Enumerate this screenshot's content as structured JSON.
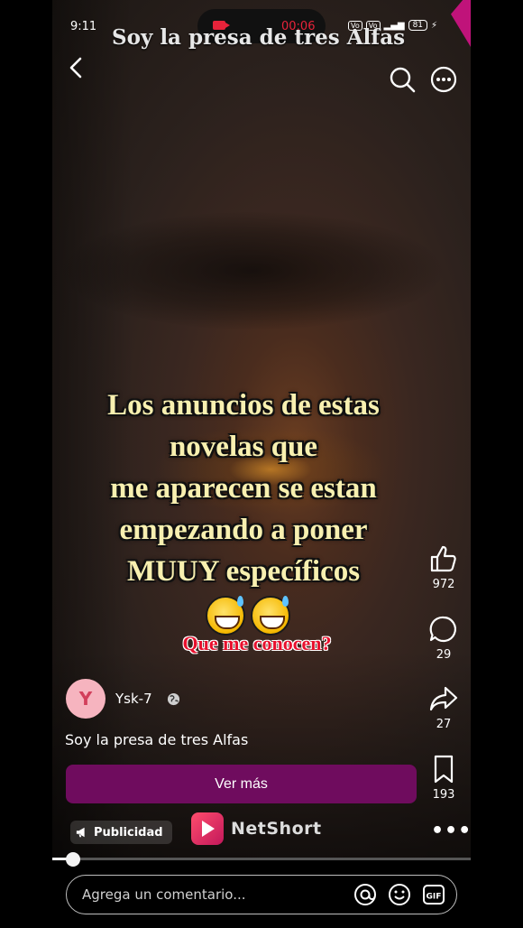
{
  "status_bar": {
    "time": "9:11",
    "recording_time": "00:06",
    "battery": "81"
  },
  "video": {
    "title": "Soy la presa de tres Alfas",
    "overlay_lines": [
      "Los anuncios de estas",
      "novelas que",
      "me aparecen se estan",
      "empezando a poner",
      "MUUY específicos"
    ],
    "red_caption": "Que me conocen?",
    "progress_fraction": 0.05
  },
  "actions": {
    "likes": "972",
    "comments": "29",
    "shares": "27",
    "saves": "193"
  },
  "author": {
    "initial": "Y",
    "name": "Ysk-7"
  },
  "description": "Soy la presa de tres Alfas",
  "cta_label": "Ver más",
  "ad": {
    "badge": "Publicidad",
    "brand": "NetShort"
  },
  "comment": {
    "placeholder": "Agrega un comentario..."
  },
  "colors": {
    "cta": "#6f0c5e",
    "overlay_text": "#f8f0b0",
    "caption_red": "#e8102d",
    "avatar_bg": "#f6b4bf"
  }
}
